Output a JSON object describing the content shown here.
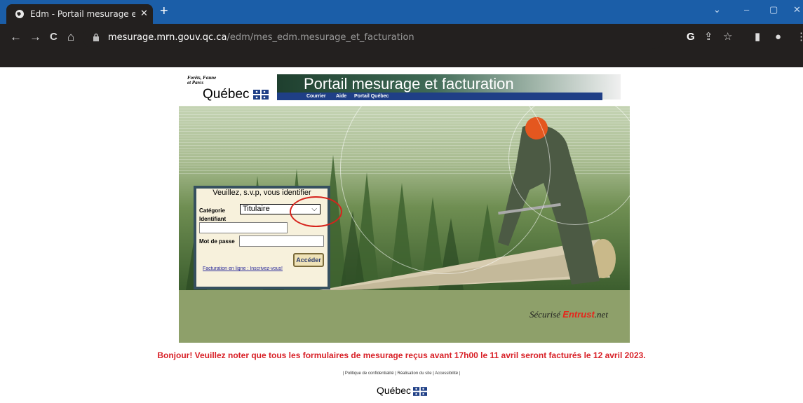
{
  "browser": {
    "tab_title": "Edm - Portail mesurage et facturation",
    "tab_close": "✕",
    "new_tab": "+",
    "url_host": "mesurage.mrn.gouv.qc.ca",
    "url_path": "/edm/mes_edm.mesurage_et_facturation",
    "nav": {
      "back": "←",
      "forward": "→",
      "reload": "C",
      "home": "⌂"
    },
    "window": {
      "tabsearch": "⌄",
      "minimize": "–",
      "maximize": "▢",
      "close": "✕"
    },
    "toolbar_icons": {
      "google": "G",
      "share": "⇪",
      "star": "☆",
      "sidepanel": "▮",
      "profile": "●",
      "menu": "⋮"
    },
    "colors": {
      "tabbar": "#1b5ea8",
      "toolbar": "#23201f"
    }
  },
  "header": {
    "ministry_line1": "Forêts, Faune",
    "ministry_line2": "et Parcs",
    "quebec": "Québec",
    "portal_title": "Portail mesurage et facturation",
    "nav_links": [
      "Courrier",
      "Aide",
      "Portail Québec"
    ]
  },
  "login": {
    "title": "Veuillez, s.v.p, vous identifier",
    "category_label": "Catégorie",
    "category_value": "Titulaire",
    "identifier_label": "Identifiant",
    "identifier_value": "",
    "password_label": "Mot de passe",
    "password_value": "",
    "submit": "Accéder",
    "signup_link": "Facturation en ligne : Inscrivez-vous!"
  },
  "security": {
    "prefix": "Sécurisé",
    "brand": "Entrust",
    "suffix": ".net"
  },
  "notice": "Bonjour! Veuillez noter que tous les formulaires de mesurage reçus avant 17h00 le 11 avril seront facturés le 12 avril 2023.",
  "footer": {
    "links": [
      "Politique de confidentialité",
      "Réalisation du site",
      "Accessibilité"
    ],
    "quebec": "Québec"
  },
  "annotation": {
    "color": "#d6231c"
  }
}
